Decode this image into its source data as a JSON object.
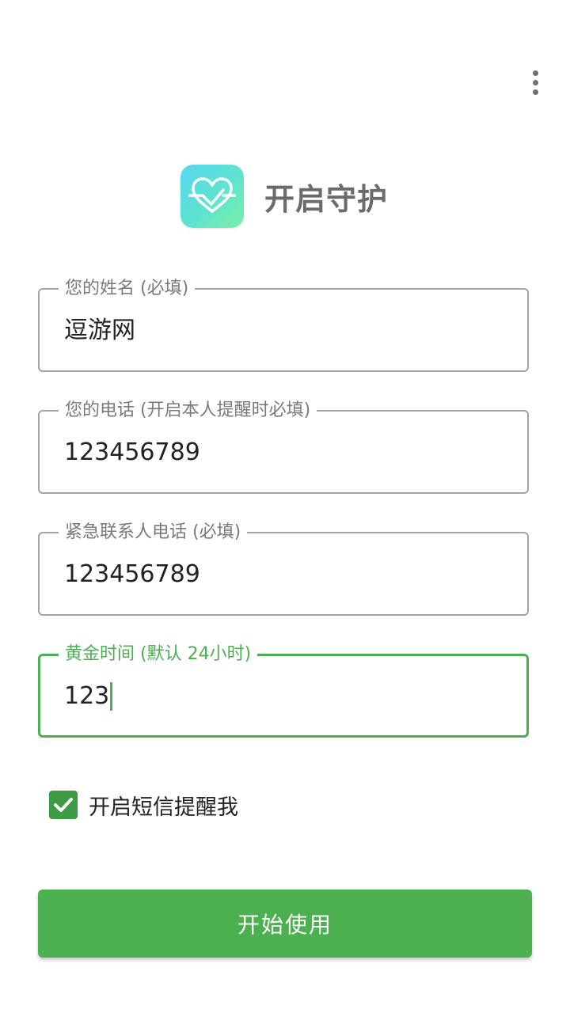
{
  "toolbar": {
    "menu_icon": "more-vertical-icon"
  },
  "header": {
    "logo_icon": "heart-check-icon",
    "title": "开启守护"
  },
  "form": {
    "name": {
      "label": "您的姓名 (必填)",
      "value": "逗游网"
    },
    "phone": {
      "label": "您的电话 (开启本人提醒时必填)",
      "value": "123456789"
    },
    "emergency_phone": {
      "label": "紧急联系人电话 (必填)",
      "value": "123456789"
    },
    "golden_time": {
      "label": "黄金时间 (默认 24小时)",
      "value": "123"
    },
    "sms_reminder": {
      "label": "开启短信提醒我",
      "checked": true
    }
  },
  "actions": {
    "start_label": "开始使用"
  },
  "colors": {
    "accent": "#4caf50",
    "checkbox": "#3e9a44",
    "border": "#a3a3a3",
    "label": "#7a7a7a",
    "title": "#6b6b6b"
  }
}
